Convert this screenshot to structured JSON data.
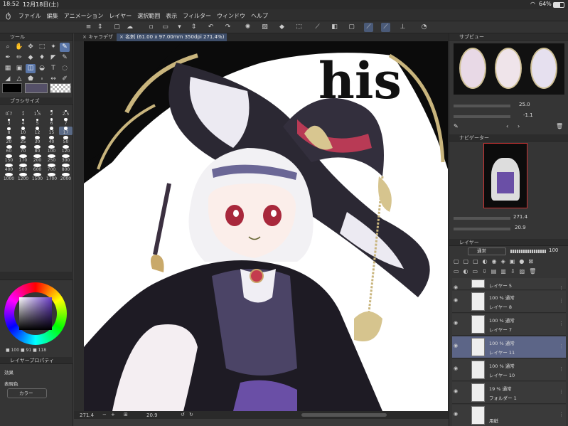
{
  "status": {
    "time": "18:52",
    "date": "12月18日(土)",
    "wifi_icon": "wifi-icon",
    "battery": "64%"
  },
  "menu": [
    "ファイル",
    "編集",
    "アニメーション",
    "レイヤー",
    "選択範囲",
    "表示",
    "フィルター",
    "ウィンドウ",
    "ヘルプ"
  ],
  "tabs": [
    {
      "label": "キャラデザ"
    },
    {
      "label": "名刺 (61.00 x 97.00mm 350dpi 271.4%)"
    }
  ],
  "tool_panel": {
    "title": "ツール"
  },
  "brush_panel": {
    "title": "ブラシサイズ",
    "sizes": [
      "0.7",
      "1",
      "1.5",
      "2",
      "2.5",
      "3",
      "4",
      "5",
      "6",
      "7",
      "8",
      "10",
      "12",
      "15",
      "17",
      "20",
      "25",
      "30",
      "40",
      "50",
      "60",
      "70",
      "80",
      "100",
      "120",
      "150",
      "170",
      "200",
      "250",
      "300",
      "400",
      "500",
      "600",
      "700",
      "800",
      "1000",
      "1200",
      "1500",
      "1700",
      "2000"
    ],
    "selected": "17"
  },
  "color_panel": {
    "r": "100",
    "g": "91",
    "b": "118"
  },
  "layer_property": {
    "title": "レイヤープロパティ",
    "effect_label": "効果",
    "expression_label": "表現色",
    "expression_value": "カラー"
  },
  "sub_view": {
    "title": "サブビュー",
    "zoom": "25.0",
    "angle": "-1.1"
  },
  "navigator": {
    "title": "ナビゲーター",
    "zoom": "271.4",
    "angle": "20.9"
  },
  "layers_panel": {
    "title": "レイヤー",
    "blend_mode": "通常",
    "opacity": "100"
  },
  "layers": [
    {
      "name": "レイヤー 5",
      "mode": ""
    },
    {
      "name": "レイヤー 8",
      "mode": "100 % 通常"
    },
    {
      "name": "レイヤー 7",
      "mode": "100 % 通常"
    },
    {
      "name": "レイヤー 11",
      "mode": "100 % 通常",
      "selected": true
    },
    {
      "name": "レイヤー 10",
      "mode": "100 % 通常"
    },
    {
      "name": "フォルダー 1",
      "mode": "19 % 通常"
    },
    {
      "name": "用紙",
      "mode": ""
    }
  ],
  "canvas_status": {
    "zoom": "271.4",
    "angle": "20.9"
  },
  "artwork": {
    "text": "his"
  }
}
